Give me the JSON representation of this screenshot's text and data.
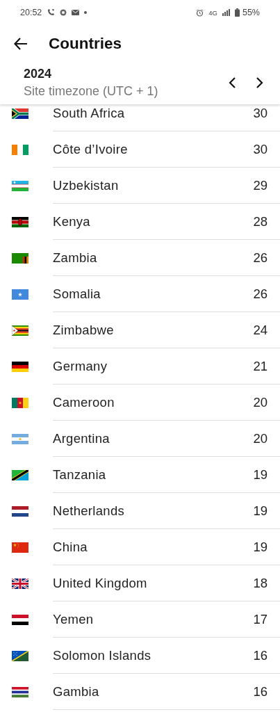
{
  "status_bar": {
    "time": "20:52",
    "network": "4G",
    "battery": "55%"
  },
  "app_bar": {
    "title": "Countries"
  },
  "period": {
    "year": "2024",
    "timezone": "Site timezone (UTC + 1)"
  },
  "countries": [
    {
      "name": "South Africa",
      "count": "30",
      "kind": "za"
    },
    {
      "name": "Côte d’Ivoire",
      "count": "30",
      "kind": "ci"
    },
    {
      "name": "Uzbekistan",
      "count": "29",
      "kind": "uz"
    },
    {
      "name": "Kenya",
      "count": "28",
      "kind": "ke"
    },
    {
      "name": "Zambia",
      "count": "26",
      "kind": "zm"
    },
    {
      "name": "Somalia",
      "count": "26",
      "kind": "so"
    },
    {
      "name": "Zimbabwe",
      "count": "24",
      "kind": "zw"
    },
    {
      "name": "Germany",
      "count": "21",
      "kind": "de"
    },
    {
      "name": "Cameroon",
      "count": "20",
      "kind": "cm"
    },
    {
      "name": "Argentina",
      "count": "20",
      "kind": "ar"
    },
    {
      "name": "Tanzania",
      "count": "19",
      "kind": "tz"
    },
    {
      "name": "Netherlands",
      "count": "19",
      "kind": "nl"
    },
    {
      "name": "China",
      "count": "19",
      "kind": "cn"
    },
    {
      "name": "United Kingdom",
      "count": "18",
      "kind": "gb"
    },
    {
      "name": "Yemen",
      "count": "17",
      "kind": "ye"
    },
    {
      "name": "Solomon Islands",
      "count": "16",
      "kind": "sb"
    },
    {
      "name": "Gambia",
      "count": "16",
      "kind": "gm"
    }
  ]
}
